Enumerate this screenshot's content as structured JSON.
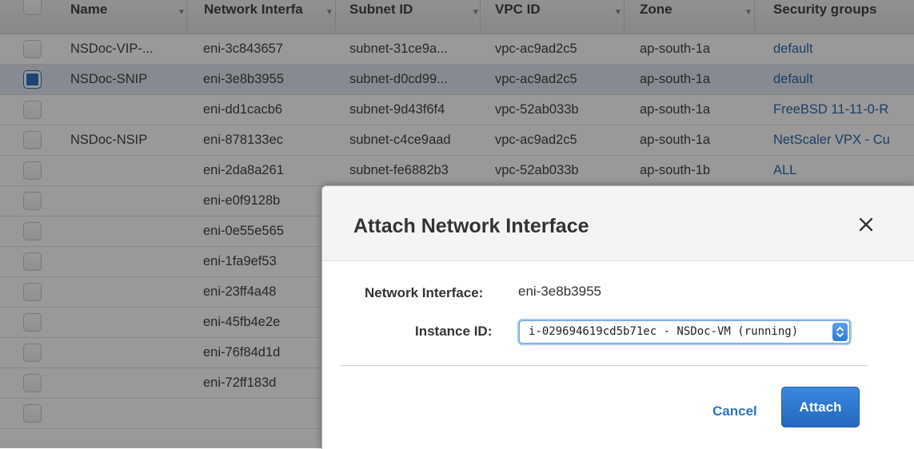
{
  "table": {
    "columns": [
      {
        "label": "Name"
      },
      {
        "label": "Network Interfa"
      },
      {
        "label": "Subnet ID"
      },
      {
        "label": "VPC ID"
      },
      {
        "label": "Zone"
      },
      {
        "label": "Security groups"
      }
    ],
    "rows": [
      {
        "selected": false,
        "name": "NSDoc-VIP-...",
        "eni": "eni-3c843657",
        "subnet": "subnet-31ce9a...",
        "vpc": "vpc-ac9ad2c5",
        "zone": "ap-south-1a",
        "sg": "default"
      },
      {
        "selected": true,
        "name": "NSDoc-SNIP",
        "eni": "eni-3e8b3955",
        "subnet": "subnet-d0cd99...",
        "vpc": "vpc-ac9ad2c5",
        "zone": "ap-south-1a",
        "sg": "default"
      },
      {
        "selected": false,
        "name": "",
        "eni": "eni-dd1cacb6",
        "subnet": "subnet-9d43f6f4",
        "vpc": "vpc-52ab033b",
        "zone": "ap-south-1a",
        "sg": "FreeBSD 11-11-0-R"
      },
      {
        "selected": false,
        "name": "NSDoc-NSIP",
        "eni": "eni-878133ec",
        "subnet": "subnet-c4ce9aad",
        "vpc": "vpc-ac9ad2c5",
        "zone": "ap-south-1a",
        "sg": "NetScaler VPX - Cu"
      },
      {
        "selected": false,
        "name": "",
        "eni": "eni-2da8a261",
        "subnet": "subnet-fe6882b3",
        "vpc": "vpc-52ab033b",
        "zone": "ap-south-1b",
        "sg": "ALL"
      },
      {
        "selected": false,
        "name": "",
        "eni": "eni-e0f9128b",
        "subnet": "",
        "vpc": "",
        "zone": "",
        "sg": ""
      },
      {
        "selected": false,
        "name": "",
        "eni": "eni-0e55e565",
        "subnet": "",
        "vpc": "",
        "zone": "",
        "sg": ""
      },
      {
        "selected": false,
        "name": "",
        "eni": "eni-1fa9ef53",
        "subnet": "",
        "vpc": "",
        "zone": "",
        "sg": ""
      },
      {
        "selected": false,
        "name": "",
        "eni": "eni-23ff4a48",
        "subnet": "",
        "vpc": "",
        "zone": "",
        "sg": ""
      },
      {
        "selected": false,
        "name": "",
        "eni": "eni-45fb4e2e",
        "subnet": "",
        "vpc": "",
        "zone": "",
        "sg": ""
      },
      {
        "selected": false,
        "name": "",
        "eni": "eni-76f84d1d",
        "subnet": "",
        "vpc": "",
        "zone": "",
        "sg": ""
      },
      {
        "selected": false,
        "name": "",
        "eni": "eni-72ff183d",
        "subnet": "",
        "vpc": "",
        "zone": "",
        "sg": ""
      },
      {
        "selected": false,
        "name": "",
        "eni": "",
        "subnet": "",
        "vpc": "",
        "zone": "",
        "sg": ""
      }
    ]
  },
  "modal": {
    "title": "Attach Network Interface",
    "close_icon": "close-icon",
    "network_interface_label": "Network Interface:",
    "network_interface_value": "eni-3e8b3955",
    "instance_id_label": "Instance ID:",
    "instance_id_value": "i-029694619cd5b71ec - NSDoc-VM (running)",
    "cancel_label": "Cancel",
    "attach_label": "Attach"
  },
  "colors": {
    "link": "#2c6aad",
    "selected_row": "#e1e7f1",
    "primary_button": "#2a74c9",
    "overlay": "rgba(0,0,0,0.40)"
  }
}
